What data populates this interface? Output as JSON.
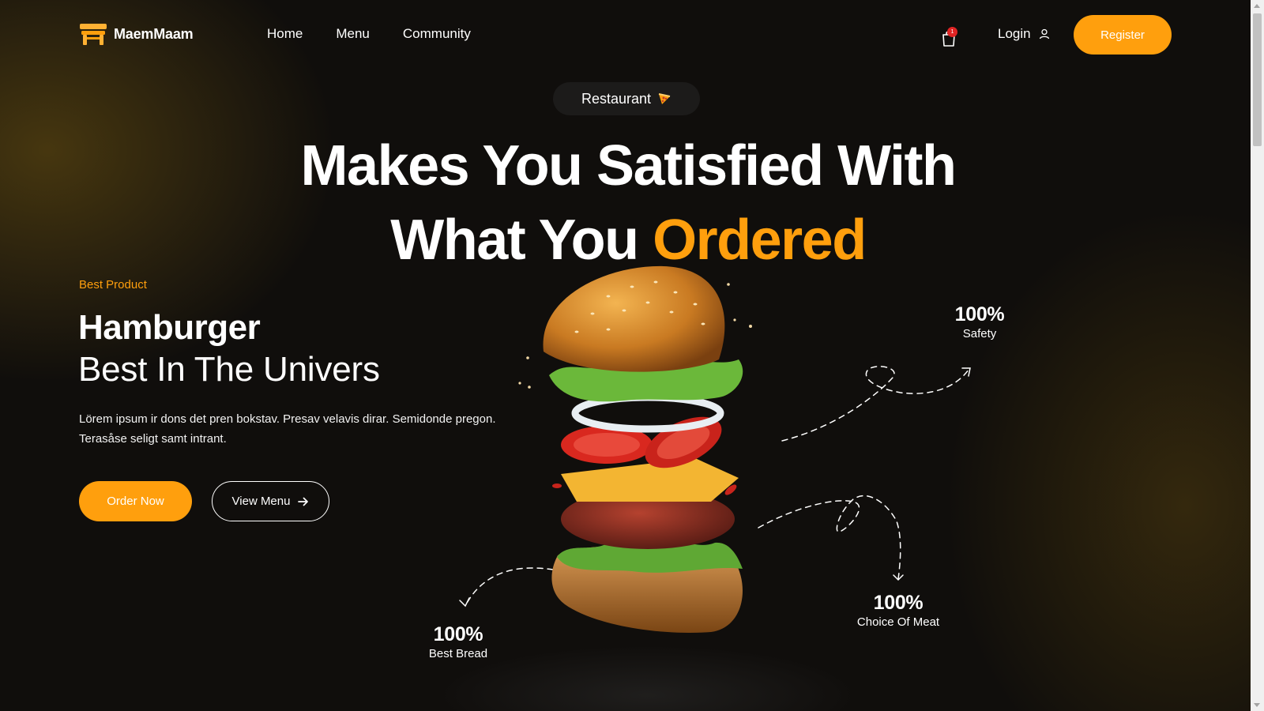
{
  "header": {
    "brand": "MaemMaam",
    "logo_icon": "table-icon",
    "nav": [
      "Home",
      "Menu",
      "Community"
    ],
    "cart_icon": "shopping-bag-icon",
    "cart_count": "1",
    "login_label": "Login",
    "login_icon": "user-icon",
    "register_label": "Register"
  },
  "hero": {
    "tag_label": "Restaurant",
    "tag_icon": "pizza-slice-icon",
    "headline_line1": "Makes You Satisfied With",
    "headline_line2_prefix": "What You",
    "headline_line2_accent": "Ordered"
  },
  "product": {
    "eyebrow": "Best Product",
    "title": "Hamburger",
    "subtitle": "Best In The Univers",
    "description_line1": "Lörem ipsum ir dons det pren bokstav. Presav velavis dirar. Semidonde pregon.",
    "description_line2": "Terasåse seligt samt intrant.",
    "order_label": "Order Now",
    "view_menu_label": "View Menu",
    "view_menu_icon": "arrow-right-icon"
  },
  "stats": [
    {
      "value": "100%",
      "label": "Safety"
    },
    {
      "value": "100%",
      "label": "Choice Of Meat"
    },
    {
      "value": "100%",
      "label": "Best Bread"
    }
  ],
  "colors": {
    "accent": "#ff9f0d",
    "background": "#100e0c",
    "badge": "#e02424"
  }
}
